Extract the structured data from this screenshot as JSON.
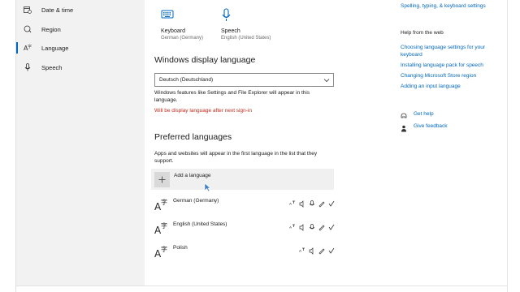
{
  "sidebar": {
    "items": [
      {
        "label": "Date & time",
        "icon": "calendar-clock-icon"
      },
      {
        "label": "Region",
        "icon": "globe-pin-icon"
      },
      {
        "label": "Language",
        "icon": "language-icon",
        "selected": true
      },
      {
        "label": "Speech",
        "icon": "microphone-icon"
      }
    ]
  },
  "main": {
    "options": [
      {
        "title": "Keyboard",
        "subtitle": "German (Germany)",
        "icon": "keyboard-icon"
      },
      {
        "title": "Speech",
        "subtitle": "English (United States)",
        "icon": "microphone-icon"
      }
    ],
    "display_language": {
      "heading": "Windows display language",
      "selected": "Deutsch (Deutschland)",
      "description": "Windows features like Settings and File Explorer will appear in this language.",
      "warning": "Will be display language after next sign-in"
    },
    "preferred": {
      "heading": "Preferred languages",
      "description": "Apps and websites will appear in the first language in the list that they support.",
      "add_label": "Add a language",
      "languages": [
        {
          "name": "German (Germany)"
        },
        {
          "name": "English (United States)"
        },
        {
          "name": "Polish"
        }
      ]
    }
  },
  "aside": {
    "top_link": "Spelling, typing, & keyboard settings",
    "help_heading": "Help from the web",
    "help_links": [
      "Choosing language settings for your keyboard",
      "Installing language pack for speech",
      "Changing Microsoft Store region",
      "Adding an input language"
    ],
    "get_help": "Get help",
    "give_feedback": "Give feedback"
  },
  "colors": {
    "accent": "#0067c0",
    "warning": "#c42b1c",
    "sidebar_bg": "#f2f2f2"
  }
}
